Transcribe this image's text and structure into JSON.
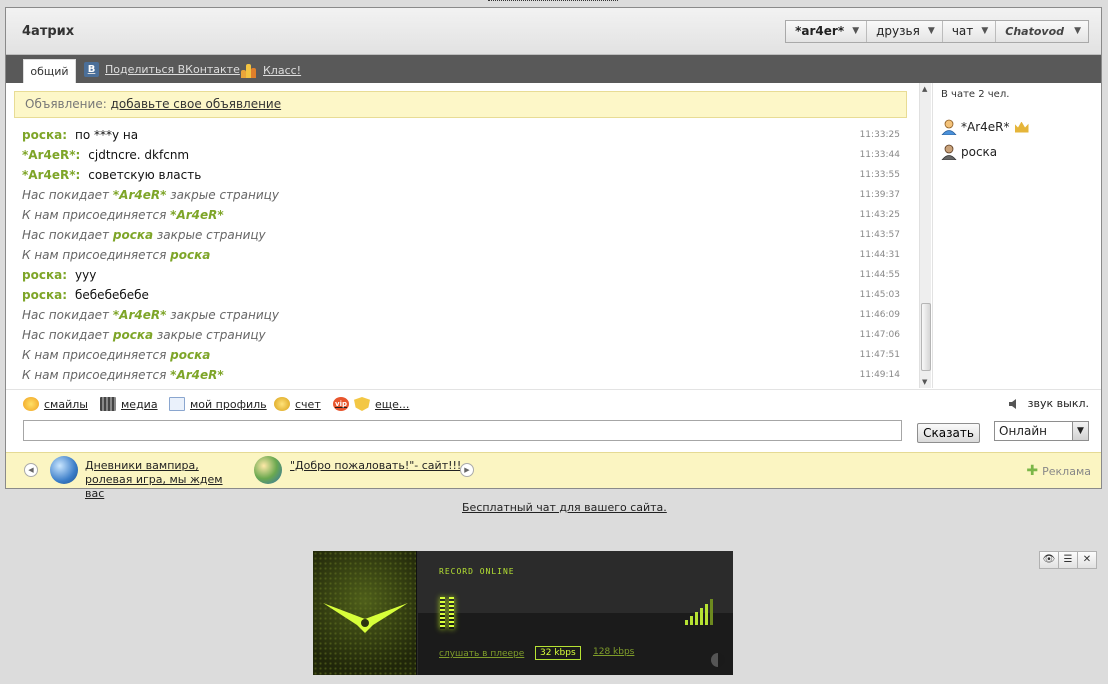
{
  "app": {
    "title": "4атрих",
    "brand": "Chatovod"
  },
  "top_menu": [
    {
      "label": "*ar4er*",
      "bold": true
    },
    {
      "label": "друзья"
    },
    {
      "label": "чат"
    }
  ],
  "tabs": {
    "main_tab": "общий",
    "share_vk": "Поделиться ВКонтакте",
    "share_ok": "Класс!"
  },
  "announcement": {
    "prefix": "Объявление:",
    "link": "добавьте свое объявление"
  },
  "messages": [
    {
      "type": "user",
      "nick": "роска:",
      "text": "по ***у на",
      "time": "11:33:25"
    },
    {
      "type": "user",
      "nick": "*Ar4eR*:",
      "text": "cjdtncre. dkfcnm",
      "time": "11:33:44"
    },
    {
      "type": "user",
      "nick": "*Ar4eR*:",
      "text": "советскую власть",
      "time": "11:33:55"
    },
    {
      "type": "sys",
      "pre": "Нас покидает",
      "nick": "*Ar4eR*",
      "post": "закрые страницу",
      "time": "11:39:37"
    },
    {
      "type": "sys",
      "pre": "К нам присоединяется",
      "nick": "*Ar4eR*",
      "post": "",
      "time": "11:43:25"
    },
    {
      "type": "sys",
      "pre": "Нас покидает",
      "nick": "роска",
      "post": "закрые страницу",
      "time": "11:43:57"
    },
    {
      "type": "sys",
      "pre": "К нам присоединяется",
      "nick": "роска",
      "post": "",
      "time": "11:44:31"
    },
    {
      "type": "user",
      "nick": "роска:",
      "text": "ууу",
      "time": "11:44:55"
    },
    {
      "type": "user",
      "nick": "роска:",
      "text": "бебебебебе",
      "time": "11:45:03"
    },
    {
      "type": "sys",
      "pre": "Нас покидает",
      "nick": "*Ar4eR*",
      "post": "закрые страницу",
      "time": "11:46:09"
    },
    {
      "type": "sys",
      "pre": "Нас покидает",
      "nick": "роска",
      "post": "закрые страницу",
      "time": "11:47:06"
    },
    {
      "type": "sys",
      "pre": "К нам присоединяется",
      "nick": "роска",
      "post": "",
      "time": "11:47:51"
    },
    {
      "type": "sys",
      "pre": "К нам присоединяется",
      "nick": "*Ar4eR*",
      "post": "",
      "time": "11:49:14"
    }
  ],
  "users": {
    "count_label": "В чате 2 чел.",
    "list": [
      {
        "name": "*Ar4eR*",
        "admin": true
      },
      {
        "name": "роска",
        "admin": false
      }
    ]
  },
  "toolbar": {
    "smileys": "смайлы",
    "media": "медиа",
    "profile": "мой профиль",
    "account": "счет",
    "vip": "vip",
    "more": "еще...",
    "sound": "звук выкл."
  },
  "input": {
    "value": "",
    "send_label": "Сказать",
    "status_value": "Онлайн"
  },
  "ads": {
    "item1": "Дневники вампира, ролевая игра, мы ждем вас",
    "item2": "\"Добро пожаловать!\"- сайт!!!",
    "right_label": "Реклама"
  },
  "footer": {
    "free_chat_link": "Бесплатный чат для вашего сайта."
  },
  "player": {
    "station": "RECORD ONLINE",
    "listen_label": "слушать в плеере",
    "kbps_active": "32 kbps",
    "kbps_other": "128 kbps"
  },
  "colors": {
    "nick_green": "#7ea528",
    "tabbar": "#595959",
    "announce_bg": "#fdf7c8",
    "player_accent": "#b6e233"
  }
}
